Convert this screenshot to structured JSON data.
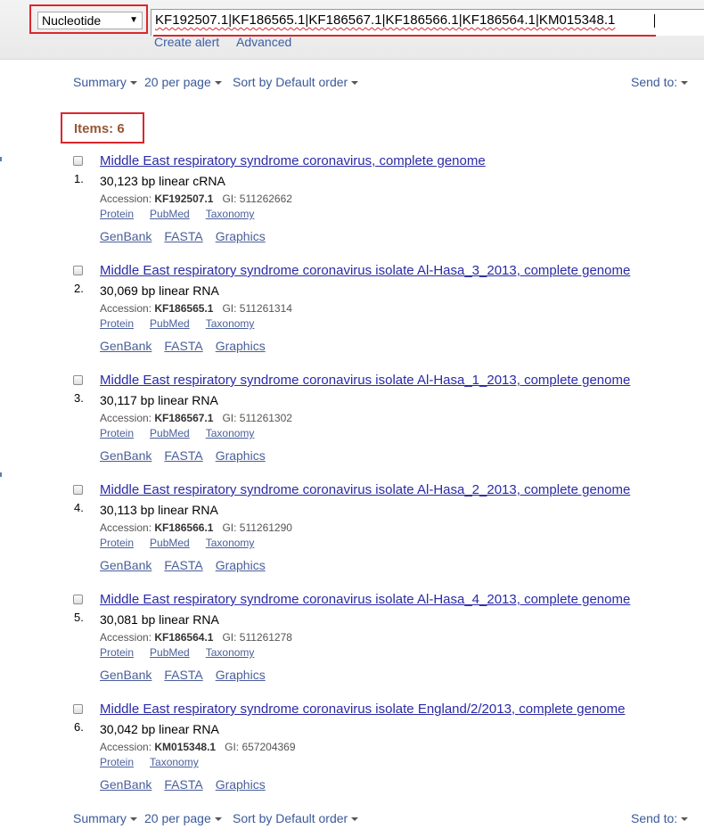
{
  "search": {
    "database": "Nucleotide",
    "term": "KF192507.1|KF186565.1|KF186567.1|KF186566.1|KF186564.1|KM015348.1",
    "create_alert": "Create alert",
    "advanced": "Advanced"
  },
  "toolbar": {
    "summary": "Summary",
    "per_page": "20 per page",
    "sort": "Sort by Default order",
    "send_to": "Send to:"
  },
  "items_count": "Items: 6",
  "results": [
    {
      "num": "1.",
      "title": "Middle East respiratory syndrome coronavirus, complete genome",
      "desc": "30,123 bp linear cRNA",
      "accession_label": "Accession:",
      "accession": "KF192507.1",
      "gi": "GI: 511262662",
      "links": [
        "Protein",
        "PubMed",
        "Taxonomy"
      ],
      "formats": [
        "GenBank",
        "FASTA",
        "Graphics"
      ]
    },
    {
      "num": "2.",
      "title": "Middle East respiratory syndrome coronavirus isolate Al-Hasa_3_2013, complete genome",
      "desc": "30,069 bp linear RNA",
      "accession_label": "Accession:",
      "accession": "KF186565.1",
      "gi": "GI: 511261314",
      "links": [
        "Protein",
        "PubMed",
        "Taxonomy"
      ],
      "formats": [
        "GenBank",
        "FASTA",
        "Graphics"
      ]
    },
    {
      "num": "3.",
      "title": "Middle East respiratory syndrome coronavirus isolate Al-Hasa_1_2013, complete genome",
      "desc": "30,117 bp linear RNA",
      "accession_label": "Accession:",
      "accession": "KF186567.1",
      "gi": "GI: 511261302",
      "links": [
        "Protein",
        "PubMed",
        "Taxonomy"
      ],
      "formats": [
        "GenBank",
        "FASTA",
        "Graphics"
      ]
    },
    {
      "num": "4.",
      "title": "Middle East respiratory syndrome coronavirus isolate Al-Hasa_2_2013, complete genome",
      "desc": "30,113 bp linear RNA",
      "accession_label": "Accession:",
      "accession": "KF186566.1",
      "gi": "GI: 511261290",
      "links": [
        "Protein",
        "PubMed",
        "Taxonomy"
      ],
      "formats": [
        "GenBank",
        "FASTA",
        "Graphics"
      ]
    },
    {
      "num": "5.",
      "title": "Middle East respiratory syndrome coronavirus isolate Al-Hasa_4_2013, complete genome",
      "desc": "30,081 bp linear RNA",
      "accession_label": "Accession:",
      "accession": "KF186564.1",
      "gi": "GI: 511261278",
      "links": [
        "Protein",
        "PubMed",
        "Taxonomy"
      ],
      "formats": [
        "GenBank",
        "FASTA",
        "Graphics"
      ]
    },
    {
      "num": "6.",
      "title": "Middle East respiratory syndrome coronavirus isolate England/2/2013, complete genome",
      "desc": "30,042 bp linear RNA",
      "accession_label": "Accession:",
      "accession": "KM015348.1",
      "gi": "GI: 657204369",
      "links": [
        "Protein",
        "Taxonomy"
      ],
      "formats": [
        "GenBank",
        "FASTA",
        "Graphics"
      ]
    }
  ],
  "colors": {
    "highlight_border": "#d9272e",
    "result_link": "#2a2aa6",
    "items_count": "#985735",
    "toolbar_link": "#3a5a9a"
  }
}
